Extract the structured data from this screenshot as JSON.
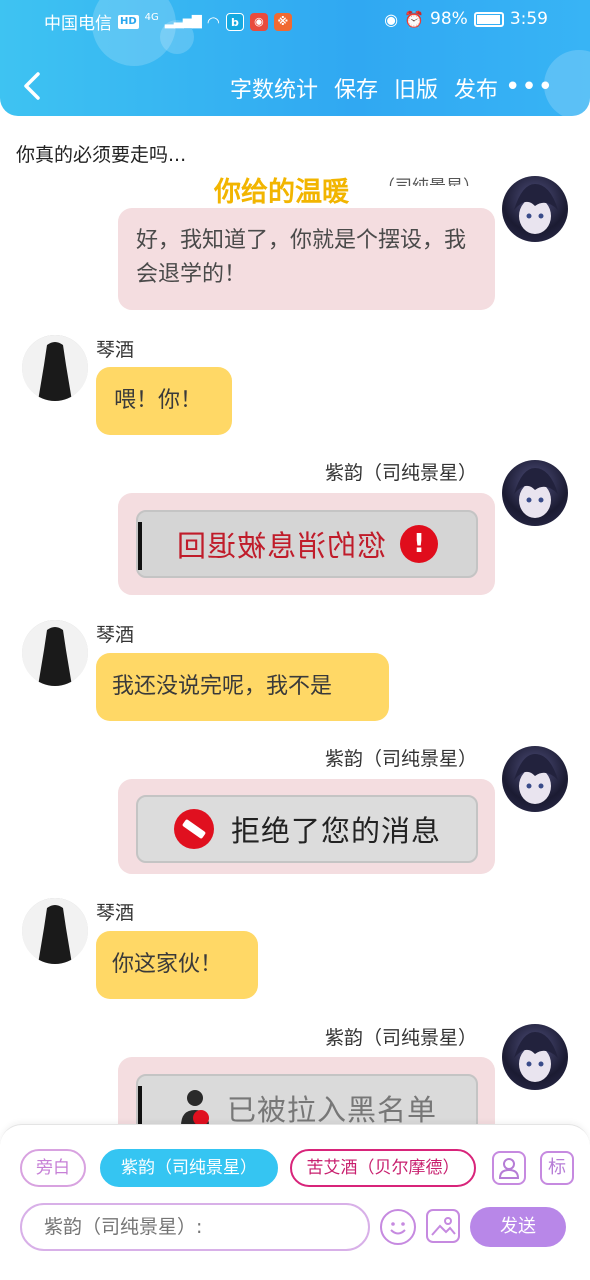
{
  "status_bar": {
    "carrier": "中国电信",
    "hd": "HD",
    "network": "4G",
    "battery": "98%",
    "time": "3:59"
  },
  "nav": {
    "actions": [
      "字数统计",
      "保存",
      "旧版",
      "发布"
    ],
    "more": "•••"
  },
  "topic": "你真的必须要走吗...",
  "overlay_title": "你给的温暖",
  "clipped_name": "（司纯景星）",
  "messages": [
    {
      "side": "right",
      "text": "好，我知道了，你就是个摆设，我会退学的！"
    },
    {
      "side": "left",
      "name": "琴酒",
      "text": "喂！你！"
    },
    {
      "side": "right",
      "name": "紫韵（司纯景星）",
      "sys_text": "您的消息被退回",
      "sys_icon": "!"
    },
    {
      "side": "left",
      "name": "琴酒",
      "text": "我还没说完呢，我不是"
    },
    {
      "side": "right",
      "name": "紫韵（司纯景星）",
      "sys_text": "拒绝了您的消息"
    },
    {
      "side": "left",
      "name": "琴酒",
      "text": "你这家伙！"
    },
    {
      "side": "right",
      "name": "紫韵（司纯景星）",
      "sys_text": "已被拉入黑名单"
    }
  ],
  "panel": {
    "roles": [
      "旁白",
      "紫韵（司纯景星）",
      "苦艾酒（贝尔摩德）"
    ],
    "mark_label": "标",
    "input_placeholder": "紫韵（司纯景星）:",
    "send_label": "发送"
  }
}
